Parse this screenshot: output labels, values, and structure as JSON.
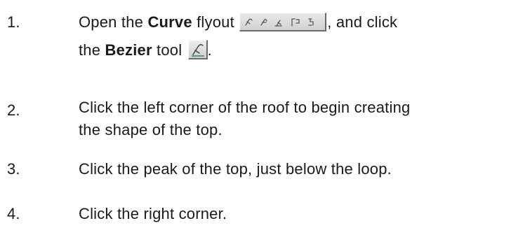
{
  "steps": [
    {
      "number": "1.",
      "line1_a": "Open the ",
      "line1_bold": "Curve",
      "line1_b": " flyout",
      "line1_c": ", and click",
      "line2_a": "the ",
      "line2_bold": "Bezier",
      "line2_b": " tool",
      "line2_c": "."
    },
    {
      "number": "2.",
      "line1": "Click the left corner of the roof to begin creating",
      "line2": "the shape of the top."
    },
    {
      "number": "3.",
      "line1": "Click the peak of the top, just below the loop."
    },
    {
      "number": "4.",
      "line1": "Click the right corner."
    }
  ],
  "icons": {
    "flyout": "curve-flyout-toolbar-icon",
    "bezier": "bezier-tool-icon"
  }
}
